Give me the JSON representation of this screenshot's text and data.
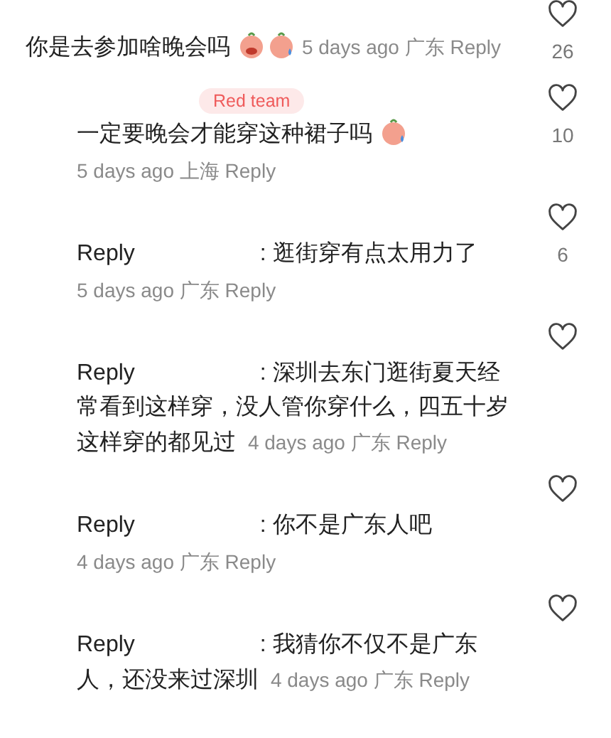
{
  "comment": {
    "text": "你是去参加啥晚会吗",
    "stickers": [
      {
        "kind": "crying"
      },
      {
        "kind": "sweat"
      }
    ],
    "time": "5 days ago",
    "location": "广东",
    "reply": "Reply",
    "meta_inline": true,
    "likes": "26",
    "children": [
      {
        "badge": "Red team",
        "text": "一定要晚会才能穿这种裙子吗",
        "stickers": [
          {
            "kind": "sweat"
          }
        ],
        "time": "5 days ago",
        "location": "上海",
        "reply": "Reply",
        "meta_inline": false,
        "likes": "10"
      },
      {
        "reply_label": "Reply",
        "text": ": 逛街穿有点太用力了",
        "time": "5 days ago",
        "location": "广东",
        "reply": "Reply",
        "meta_inline": false,
        "likes": "6"
      },
      {
        "reply_label": "Reply",
        "text": ": 深圳去东门逛街夏天经常看到这样穿，没人管你穿什么，四五十岁这样穿的都见过",
        "time": "4 days ago",
        "location": "广东",
        "reply": "Reply",
        "meta_inline": true
      },
      {
        "reply_label": "Reply",
        "text": ": 你不是广东人吧",
        "time": "4 days ago",
        "location": "广东",
        "reply": "Reply",
        "meta_inline": false
      },
      {
        "reply_label": "Reply",
        "text": ": 我猜你不仅不是广东人，还没来过深圳",
        "time": "4 days ago",
        "location": "广东",
        "reply": "Reply",
        "meta_inline": true
      }
    ]
  }
}
